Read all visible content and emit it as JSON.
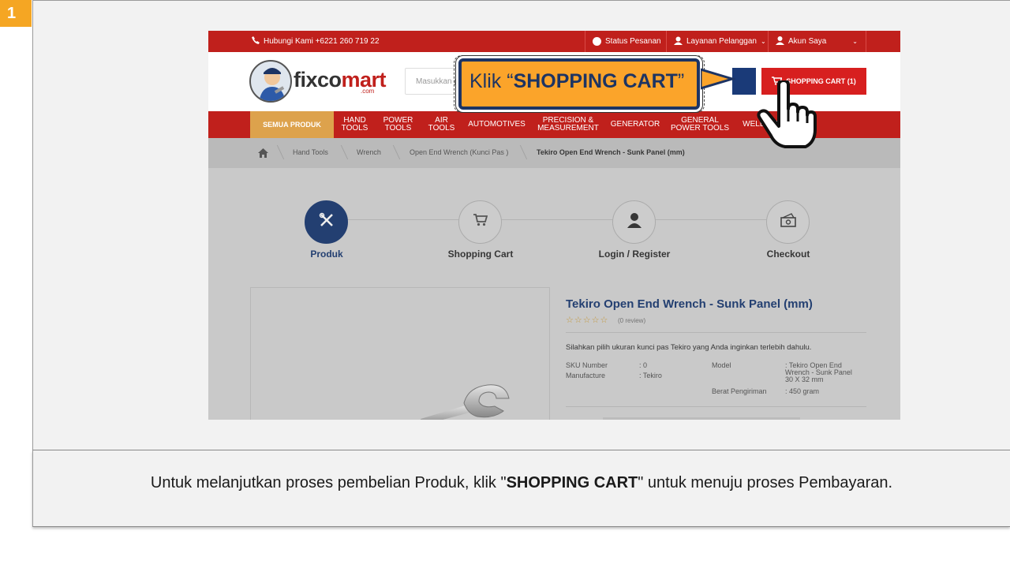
{
  "step": {
    "number": "1"
  },
  "topbar": {
    "phone": "Hubungi Kami +6221 260 719 22",
    "status": "Status Pesanan",
    "service": "Layanan Pelanggan",
    "account": "Akun Saya"
  },
  "header": {
    "logo_main": "fixco",
    "logo_accent": "mart",
    "logo_sub": ".com",
    "search_placeholder": "Masukkan pencarian",
    "cart_label": "SHOPPING CART (1)"
  },
  "menu": {
    "all": "SEMUA PRODUK",
    "items": [
      {
        "l1": "HAND",
        "l2": "TOOLS"
      },
      {
        "l1": "POWER",
        "l2": "TOOLS"
      },
      {
        "l1": "AIR",
        "l2": "TOOLS"
      },
      {
        "l1": "AUTOMOTIVES",
        "l2": ""
      },
      {
        "l1": "PRECISION &",
        "l2": "MEASUREMENT"
      },
      {
        "l1": "GENERATOR",
        "l2": ""
      },
      {
        "l1": "GENERAL",
        "l2": "POWER TOOLS"
      },
      {
        "l1": "WELDING",
        "l2": ""
      }
    ]
  },
  "breadcrumb": [
    "Hand Tools",
    "Wrench",
    "Open End Wrench (Kunci Pas )",
    "Tekiro Open End Wrench - Sunk Panel (mm)"
  ],
  "checkout_steps": [
    "Produk",
    "Shopping Cart",
    "Login / Register",
    "Checkout"
  ],
  "product": {
    "title": "Tekiro Open End Wrench - Sunk Panel (mm)",
    "stars": "☆☆☆☆☆",
    "review": "(0 review)",
    "description": "Silahkan pilih ukuran kunci pas Tekiro yang Anda inginkan terlebih dahulu.",
    "sku_label": "SKU Number",
    "sku_value": ": 0",
    "manufacture_label": "Manufacture",
    "manufacture_value": ": Tekiro",
    "model_label": "Model",
    "model_value_1": ": Tekiro Open End",
    "model_value_2": "Wrench - Sunk Panel",
    "model_value_3": "30 X 32 mm",
    "weight_label": "Berat Pengiriman",
    "weight_value": ": 450 gram"
  },
  "callout": {
    "prefix": "Klik “",
    "bold": "SHOPPING CART",
    "suffix": "”"
  },
  "caption": {
    "pre": "Untuk melanjutkan proses pembelian Produk, klik \"",
    "bold": "SHOPPING CART",
    "post": "\" untuk menuju proses Pembayaran."
  },
  "colors": {
    "brand_red": "#c0201c",
    "navy": "#1e3d74",
    "callout_orange": "#fba42a",
    "menu_gold": "#dda24c"
  }
}
